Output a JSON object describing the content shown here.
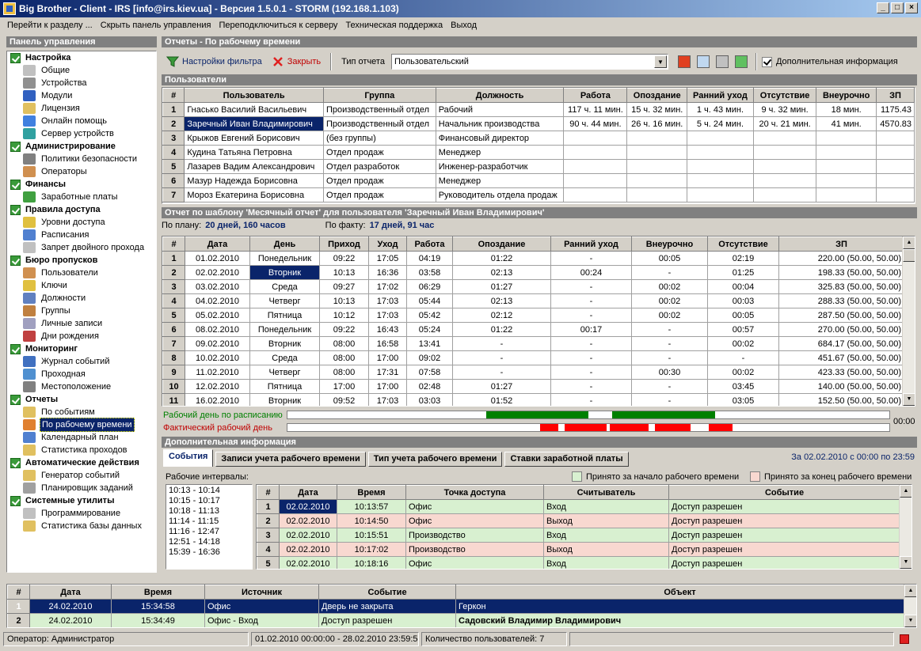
{
  "window": {
    "title": "Big Brother - Client - IRS [info@irs.kiev.ua] - Версия 1.5.0.1 - STORM (192.168.1.103)"
  },
  "menu": [
    "Перейти к разделу ...",
    "Скрыть панель управления",
    "Переподключиться к серверу",
    "Техническая поддержка",
    "Выход"
  ],
  "left_panel": {
    "title": "Панель управления",
    "groups": [
      {
        "label": "Настройка",
        "items": [
          {
            "label": "Общие",
            "icon": "settings-icon",
            "color": "#c0c0c0"
          },
          {
            "label": "Устройства",
            "icon": "devices-icon",
            "color": "#909090"
          },
          {
            "label": "Модули",
            "icon": "modules-icon",
            "color": "#3060c0"
          },
          {
            "label": "Лицензия",
            "icon": "license-icon",
            "color": "#e0c060"
          },
          {
            "label": "Онлайн помощь",
            "icon": "help-icon",
            "color": "#4080e0"
          },
          {
            "label": "Сервер устройств",
            "icon": "server-icon",
            "color": "#30a0a0"
          }
        ]
      },
      {
        "label": "Администрирование",
        "items": [
          {
            "label": "Политики безопасности",
            "icon": "security-icon",
            "color": "#808080"
          },
          {
            "label": "Операторы",
            "icon": "operators-icon",
            "color": "#d09050"
          }
        ]
      },
      {
        "label": "Финансы",
        "items": [
          {
            "label": "Заработные платы",
            "icon": "money-icon",
            "color": "#40a040"
          }
        ]
      },
      {
        "label": "Правила доступа",
        "items": [
          {
            "label": "Уровни доступа",
            "icon": "access-level-icon",
            "color": "#e0c040"
          },
          {
            "label": "Расписания",
            "icon": "schedule-icon",
            "color": "#5080d0"
          },
          {
            "label": "Запрет двойного прохода",
            "icon": "antipassback-icon",
            "color": "#c0c0c0"
          }
        ]
      },
      {
        "label": "Бюро пропусков",
        "items": [
          {
            "label": "Пользователи",
            "icon": "users-icon",
            "color": "#d09050"
          },
          {
            "label": "Ключи",
            "icon": "key-icon",
            "color": "#e0c040"
          },
          {
            "label": "Должности",
            "icon": "positions-icon",
            "color": "#6080c0"
          },
          {
            "label": "Группы",
            "icon": "groups-icon",
            "color": "#c08040"
          },
          {
            "label": "Личные записи",
            "icon": "records-icon",
            "color": "#a0a0c0"
          },
          {
            "label": "Дни рождения",
            "icon": "birthday-icon",
            "color": "#c04040"
          }
        ]
      },
      {
        "label": "Мониторинг",
        "items": [
          {
            "label": "Журнал событий",
            "icon": "journal-icon",
            "color": "#4070c0"
          },
          {
            "label": "Проходная",
            "icon": "checkpoint-icon",
            "color": "#5090d0"
          },
          {
            "label": "Местоположение",
            "icon": "location-icon",
            "color": "#808080"
          }
        ]
      },
      {
        "label": "Отчеты",
        "items": [
          {
            "label": "По событиям",
            "icon": "report-events-icon",
            "color": "#e0c060"
          },
          {
            "label": "По рабочему времени",
            "icon": "report-clock-icon",
            "color": "#e08030",
            "selected": true
          },
          {
            "label": "Календарный план",
            "icon": "calendar-icon",
            "color": "#5080d0"
          },
          {
            "label": "Статистика проходов",
            "icon": "stats-icon",
            "color": "#e0c060"
          }
        ]
      },
      {
        "label": "Автоматические действия",
        "items": [
          {
            "label": "Генератор событий",
            "icon": "generator-icon",
            "color": "#e0c060"
          },
          {
            "label": "Планировщик заданий",
            "icon": "scheduler-icon",
            "color": "#a0a0a0"
          }
        ]
      },
      {
        "label": "Системные утилиты",
        "items": [
          {
            "label": "Программирование",
            "icon": "programming-icon",
            "color": "#c0c0c0"
          },
          {
            "label": "Статистика базы данных",
            "icon": "db-stats-icon",
            "color": "#e0c060"
          }
        ]
      }
    ]
  },
  "reports": {
    "title": "Отчеты - По рабочему времени",
    "toolbar": {
      "filter": "Настройки фильтра",
      "close": "Закрыть",
      "report_type_label": "Тип отчета",
      "report_type_value": "Пользовательский",
      "extra_info": "Дополнительная информация"
    }
  },
  "users": {
    "title": "Пользователи",
    "columns": [
      "#",
      "Пользователь",
      "Группа",
      "Должность",
      "Работа",
      "Опоздание",
      "Ранний уход",
      "Отсутствие",
      "Внеурочно",
      "ЗП"
    ],
    "rows": [
      [
        "1",
        "Гнасько Василий Васильевич",
        "Производственный отдел",
        "Рабочий",
        "117 ч. 11 мин.",
        "15 ч. 32 мин.",
        "1 ч. 43 мин.",
        "9 ч. 32 мин.",
        "18 мин.",
        "1175.43"
      ],
      [
        "2",
        "Заречный Иван Владимирович",
        "Производственный отдел",
        "Начальник производства",
        "90 ч. 44 мин.",
        "26 ч. 16 мин.",
        "5 ч. 24 мин.",
        "20 ч. 21 мин.",
        "41 мин.",
        "4570.83"
      ],
      [
        "3",
        "Крыжов Евгений Борисович",
        "(без группы)",
        "Финансовый директор",
        "",
        "",
        "",
        "",
        "",
        ""
      ],
      [
        "4",
        "Кудина Татьяна Петровна",
        "Отдел продаж",
        "Менеджер",
        "",
        "",
        "",
        "",
        "",
        ""
      ],
      [
        "5",
        "Лазарев Вадим Александрович",
        "Отдел разработок",
        "Инженер-разработчик",
        "",
        "",
        "",
        "",
        "",
        ""
      ],
      [
        "6",
        "Мазур Надежда Борисовна",
        "Отдел продаж",
        "Менеджер",
        "",
        "",
        "",
        "",
        "",
        ""
      ],
      [
        "7",
        "Мороз Екатерина Борисовна",
        "Отдел продаж",
        "Руководитель отдела продаж",
        "",
        "",
        "",
        "",
        "",
        ""
      ]
    ]
  },
  "monthly": {
    "title": "Отчет по шаблону 'Месячный отчет' для пользователя 'Заречный Иван Владимирович'",
    "plan_label": "По плану:",
    "plan_value": "20 дней, 160 часов",
    "fact_label": "По факту:",
    "fact_value": "17 дней, 91 час",
    "columns": [
      "#",
      "Дата",
      "День",
      "Приход",
      "Уход",
      "Работа",
      "Опоздание",
      "Ранний уход",
      "Внеурочно",
      "Отсутствие",
      "ЗП"
    ],
    "rows": [
      [
        "1",
        "01.02.2010",
        "Понедельник",
        "09:22",
        "17:05",
        "04:19",
        "01:22",
        "-",
        "00:05",
        "02:19",
        "220.00 (50.00, 50.00)"
      ],
      [
        "2",
        "02.02.2010",
        "Вторник",
        "10:13",
        "16:36",
        "03:58",
        "02:13",
        "00:24",
        "-",
        "01:25",
        "198.33 (50.00, 50.00)"
      ],
      [
        "3",
        "03.02.2010",
        "Среда",
        "09:27",
        "17:02",
        "06:29",
        "01:27",
        "-",
        "00:02",
        "00:04",
        "325.83 (50.00, 50.00)"
      ],
      [
        "4",
        "04.02.2010",
        "Четверг",
        "10:13",
        "17:03",
        "05:44",
        "02:13",
        "-",
        "00:02",
        "00:03",
        "288.33 (50.00, 50.00)"
      ],
      [
        "5",
        "05.02.2010",
        "Пятница",
        "10:12",
        "17:03",
        "05:42",
        "02:12",
        "-",
        "00:02",
        "00:05",
        "287.50 (50.00, 50.00)"
      ],
      [
        "6",
        "08.02.2010",
        "Понедельник",
        "09:22",
        "16:43",
        "05:24",
        "01:22",
        "00:17",
        "-",
        "00:57",
        "270.00 (50.00, 50.00)"
      ],
      [
        "7",
        "09.02.2010",
        "Вторник",
        "08:00",
        "16:58",
        "13:41",
        "-",
        "-",
        "-",
        "00:02",
        "684.17 (50.00, 50.00)"
      ],
      [
        "8",
        "10.02.2010",
        "Среда",
        "08:00",
        "17:00",
        "09:02",
        "-",
        "-",
        "-",
        "-",
        "451.67 (50.00, 50.00)"
      ],
      [
        "9",
        "11.02.2010",
        "Четверг",
        "08:00",
        "17:31",
        "07:58",
        "-",
        "-",
        "00:30",
        "00:02",
        "423.33 (50.00, 50.00)"
      ],
      [
        "10",
        "12.02.2010",
        "Пятница",
        "17:00",
        "17:00",
        "02:48",
        "01:27",
        "-",
        "-",
        "03:45",
        "140.00 (50.00, 50.00)"
      ],
      [
        "11",
        "16.02.2010",
        "Вторник",
        "09:52",
        "17:03",
        "03:03",
        "01:52",
        "-",
        "-",
        "03:05",
        "152.50 (50.00, 50.00)"
      ]
    ],
    "sched_label": "Рабочий день по расписанию",
    "actual_label": "Фактический рабочий день",
    "bar_end": "00:00",
    "sched_segments": [
      [
        0.33,
        0.5,
        "#008000"
      ],
      [
        0.54,
        0.71,
        "#008000"
      ]
    ],
    "actual_segments": [
      [
        0.42,
        0.45,
        "#ff0000"
      ],
      [
        0.46,
        0.53,
        "#ff0000"
      ],
      [
        0.535,
        0.6,
        "#ff0000"
      ],
      [
        0.61,
        0.67,
        "#ff0000"
      ],
      [
        0.7,
        0.74,
        "#ff0000"
      ]
    ]
  },
  "extra": {
    "title": "Дополнительная информация",
    "tabs": [
      "События",
      "Записи учета рабочего времени",
      "Тип учета рабочего времени",
      "Ставки заработной платы"
    ],
    "date_range": "За 02.02.2010 с 00:00 по 23:59",
    "intervals_label": "Рабочие интервалы:",
    "legend_start": "Принято за начало рабочего времени",
    "legend_end": "Принято за конец рабочего времени",
    "intervals": [
      "10:13 - 10:14",
      "10:15 - 10:17",
      "10:18 - 11:13",
      "11:14 - 11:15",
      "11:16 - 12:47",
      "12:51 - 14:18",
      "15:39 - 16:36"
    ],
    "columns": [
      "#",
      "Дата",
      "Время",
      "Точка доступа",
      "Считыватель",
      "Событие"
    ],
    "rows": [
      [
        "1",
        "02.02.2010",
        "10:13:57",
        "Офис",
        "Вход",
        "Доступ разрешен",
        "green"
      ],
      [
        "2",
        "02.02.2010",
        "10:14:50",
        "Офис",
        "Выход",
        "Доступ разрешен",
        "pink"
      ],
      [
        "3",
        "02.02.2010",
        "10:15:51",
        "Производство",
        "Вход",
        "Доступ разрешен",
        "green"
      ],
      [
        "4",
        "02.02.2010",
        "10:17:02",
        "Производство",
        "Выход",
        "Доступ разрешен",
        "pink"
      ],
      [
        "5",
        "02.02.2010",
        "10:18:16",
        "Офис",
        "Вход",
        "Доступ разрешен",
        "green"
      ]
    ]
  },
  "events": {
    "columns": [
      "#",
      "Дата",
      "Время",
      "Источник",
      "Событие",
      "Объект"
    ],
    "rows": [
      [
        "1",
        "24.02.2010",
        "15:34:58",
        "Офис",
        "Дверь не закрыта",
        "Геркон",
        "selected"
      ],
      [
        "2",
        "24.02.2010",
        "15:34:49",
        "Офис - Вход",
        "Доступ разрешен",
        "Садовский Владимир Владимирович",
        "green"
      ]
    ]
  },
  "status": {
    "operator": "Оператор: Администратор",
    "range": "01.02.2010 00:00:00 - 28.02.2010 23:59:59",
    "users": "Количество пользователей: 7"
  }
}
